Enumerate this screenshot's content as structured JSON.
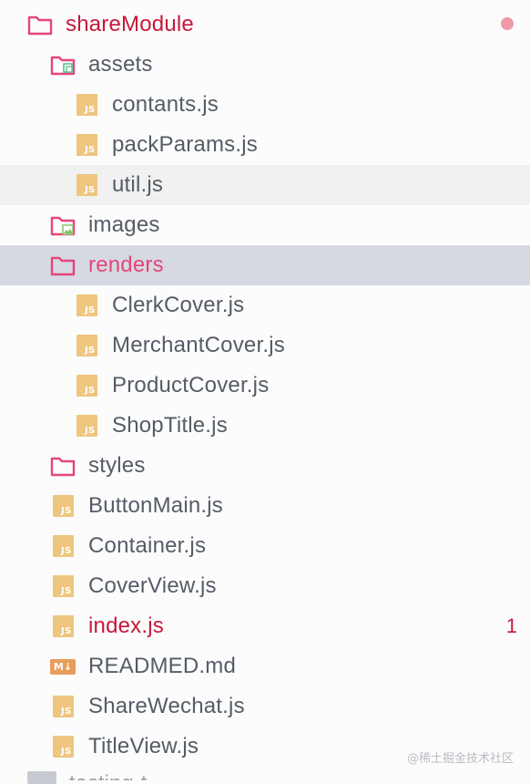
{
  "tree": [
    {
      "name": "shareModule",
      "kind": "folder",
      "depth": 0,
      "color": "red"
    },
    {
      "name": "assets",
      "kind": "folder-assets",
      "depth": 1
    },
    {
      "name": "contants.js",
      "kind": "js",
      "depth": 2
    },
    {
      "name": "packParams.js",
      "kind": "js",
      "depth": 2
    },
    {
      "name": "util.js",
      "kind": "js",
      "depth": 2,
      "state": "hover"
    },
    {
      "name": "images",
      "kind": "folder-images",
      "depth": 1
    },
    {
      "name": "renders",
      "kind": "folder",
      "depth": 1,
      "state": "selected",
      "color": "pink"
    },
    {
      "name": "ClerkCover.js",
      "kind": "js",
      "depth": 2
    },
    {
      "name": "MerchantCover.js",
      "kind": "js",
      "depth": 2
    },
    {
      "name": "ProductCover.js",
      "kind": "js",
      "depth": 2
    },
    {
      "name": "ShopTitle.js",
      "kind": "js",
      "depth": 2
    },
    {
      "name": "styles",
      "kind": "folder",
      "depth": 1
    },
    {
      "name": "ButtonMain.js",
      "kind": "js",
      "depth": 1
    },
    {
      "name": "Container.js",
      "kind": "js",
      "depth": 1
    },
    {
      "name": "CoverView.js",
      "kind": "js",
      "depth": 1
    },
    {
      "name": "index.js",
      "kind": "js",
      "depth": 1,
      "color": "red",
      "badge": "1"
    },
    {
      "name": "READMED.md",
      "kind": "md",
      "depth": 1
    },
    {
      "name": "ShareWechat.js",
      "kind": "js",
      "depth": 1
    },
    {
      "name": "TitleView.js",
      "kind": "js",
      "depth": 1
    }
  ],
  "js_badge_text": "JS",
  "md_badge_text": "M↓",
  "partial_row_label": "testing-t",
  "watermark": "@稀土掘金技术社区",
  "colors": {
    "red": "#c8173b",
    "pink": "#e5457a",
    "js": "#eec67f",
    "folder": "#e5457a",
    "selected_bg": "#d6d9e1"
  }
}
